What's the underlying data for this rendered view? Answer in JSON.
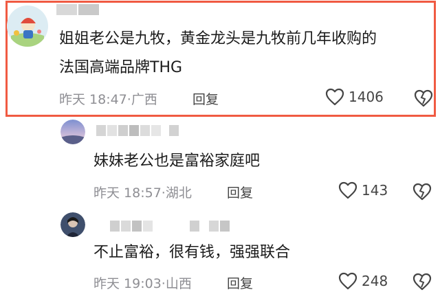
{
  "comments": [
    {
      "text_lines": [
        "姐姐老公是九牧，黄金龙头是九牧前几年收购的",
        "法国高端品牌THG"
      ],
      "time": "昨天 18:47",
      "sep": "·",
      "location": "广西",
      "reply_label": "回复",
      "like_count": "1406"
    },
    {
      "text_lines": [
        "妹妹老公也是富裕家庭吧"
      ],
      "time": "昨天 18:57",
      "sep": "·",
      "location": "湖北",
      "reply_label": "回复",
      "like_count": "143"
    },
    {
      "text_lines": [
        "不止富裕，很有钱，强强联合"
      ],
      "time": "昨天 19:03",
      "sep": "·",
      "location": "山西",
      "reply_label": "回复",
      "like_count": "248"
    }
  ],
  "icons": {
    "like": "heart-outline-icon",
    "dislike": "broken-heart-icon"
  },
  "colors": {
    "highlight_border": "#f05a42",
    "meta_text": "#8e8e93"
  }
}
